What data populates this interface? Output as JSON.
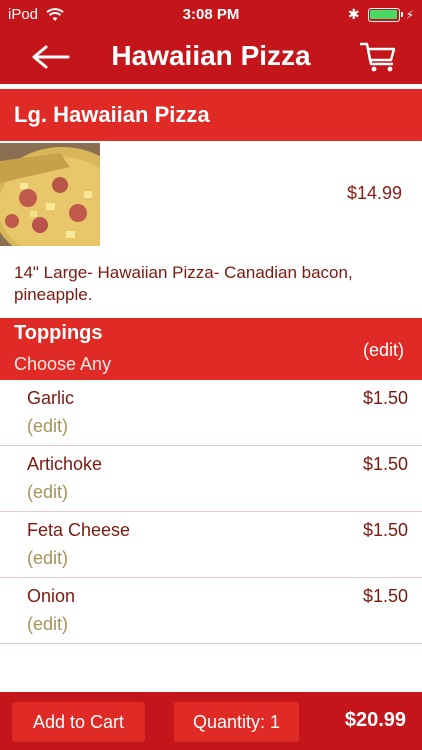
{
  "status_bar": {
    "carrier": "iPod",
    "time": "3:08 PM"
  },
  "nav": {
    "title": "Hawaiian Pizza",
    "back_icon": "arrow-left-icon",
    "cart_icon": "cart-icon"
  },
  "item": {
    "header": "Lg. Hawaiian Pizza",
    "price": "$14.99",
    "description": "14\" Large- Hawaiian Pizza- Canadian bacon, pineapple."
  },
  "toppings": {
    "title": "Toppings",
    "subtitle": "Choose Any",
    "edit_label": "(edit)",
    "items": [
      {
        "name": "Garlic",
        "price": "$1.50",
        "edit": "(edit)"
      },
      {
        "name": "Artichoke",
        "price": "$1.50",
        "edit": "(edit)"
      },
      {
        "name": "Feta Cheese",
        "price": "$1.50",
        "edit": "(edit)"
      },
      {
        "name": "Onion",
        "price": "$1.50",
        "edit": "(edit)"
      }
    ]
  },
  "footer": {
    "add_to_cart": "Add to Cart",
    "quantity": "Quantity: 1",
    "total": "$20.99"
  },
  "colors": {
    "bar_red": "#c3151a",
    "accent_red": "#df2a25",
    "text_brown": "#7a1a10",
    "edit_tan": "#a69258"
  }
}
